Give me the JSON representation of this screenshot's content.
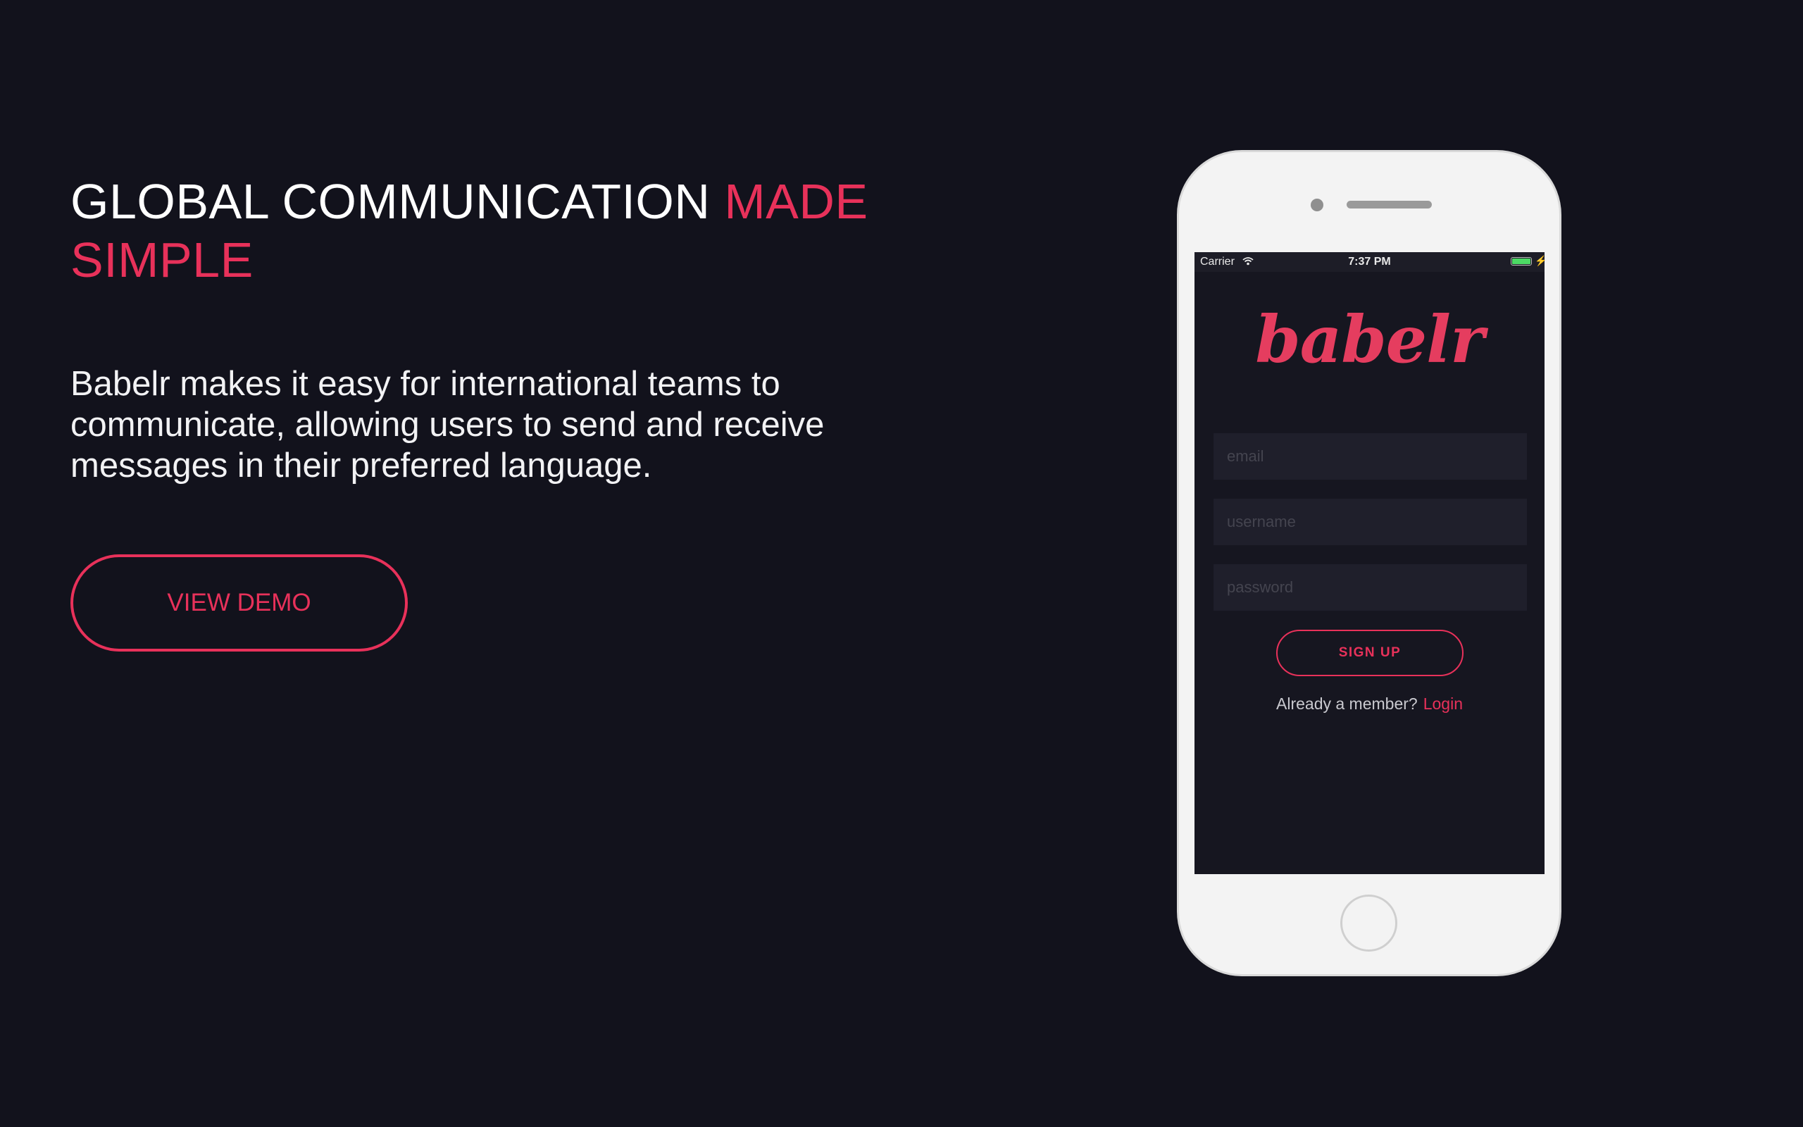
{
  "hero": {
    "headline_part1": "GLOBAL COMMUNICATION ",
    "headline_accent": "MADE SIMPLE",
    "description": "Babelr makes it easy for international teams to communicate, allowing users to send and receive messages in their preferred language.",
    "demo_button_label": "VIEW DEMO"
  },
  "phone": {
    "status_bar": {
      "carrier": "Carrier",
      "time": "7:37 PM",
      "icons": [
        "wifi-icon",
        "battery-icon",
        "charging-bolt-icon"
      ]
    },
    "app": {
      "logo_text": "babelr",
      "email_placeholder": "email",
      "username_placeholder": "username",
      "password_placeholder": "password",
      "signup_label": "SIGN UP",
      "member_prompt": "Already a member?",
      "login_label": "Login"
    }
  },
  "colors": {
    "background": "#12121c",
    "accent": "#e8315a",
    "text": "#ffffff",
    "phone_body": "#f3f3f3",
    "app_background": "#161620",
    "input_background": "#1f1f2b",
    "battery": "#4cd964"
  }
}
